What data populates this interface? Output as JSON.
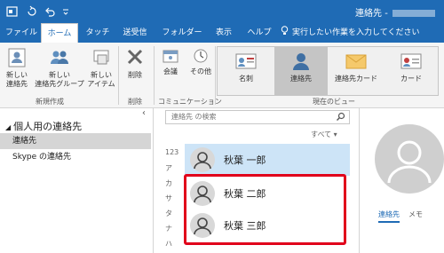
{
  "window": {
    "title": "連絡先 - "
  },
  "tabs": [
    {
      "label": "ファイル",
      "active": false
    },
    {
      "label": "ホーム",
      "active": true
    },
    {
      "label": "タッチ",
      "active": false
    },
    {
      "label": "送受信",
      "active": false
    },
    {
      "label": "フォルダー",
      "active": false
    },
    {
      "label": "表示",
      "active": false
    },
    {
      "label": "ヘルプ",
      "active": false
    }
  ],
  "tell_me": "実行したい作業を入力してください",
  "ribbon": {
    "new_contact": "新しい\n連絡先",
    "new_group": "新しい\n連絡先グループ",
    "new_items": "新しい\nアイテム",
    "group_new": "新規作成",
    "delete": "削除",
    "group_delete": "削除",
    "meeting": "会議",
    "more": "その他",
    "group_comm": "コミュニケーション",
    "views": [
      "名刺",
      "連絡先",
      "連絡先カード",
      "カード"
    ],
    "selected_view": "連絡先",
    "group_view": "現在のビュー"
  },
  "nav": {
    "header": "個人用の連絡先",
    "items": [
      {
        "label": "連絡先",
        "selected": true
      },
      {
        "label": "Skype の連絡先",
        "selected": false
      }
    ]
  },
  "list": {
    "search_placeholder": "連絡先 の検索",
    "sort_label": "すべて ▾",
    "alpha_index": [
      "123",
      "ア",
      "カ",
      "サ",
      "タ",
      "ナ",
      "ハ"
    ],
    "contacts": [
      {
        "name": "秋葉 一郎",
        "selected": true
      },
      {
        "name": "秋葉 二郎",
        "selected": false
      },
      {
        "name": "秋葉 三郎",
        "selected": false
      }
    ]
  },
  "reading": {
    "tabs": [
      "連絡先",
      "メモ"
    ]
  },
  "colors": {
    "brand": "#1f6bb5",
    "highlight_box": "#e1001b",
    "selected_row": "#cde4f7"
  }
}
